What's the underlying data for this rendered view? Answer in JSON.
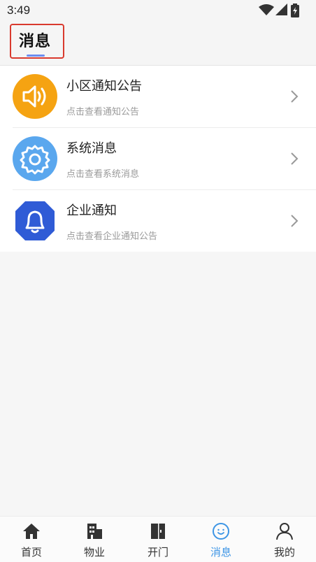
{
  "status_bar": {
    "time": "3:49",
    "icons": [
      "wifi-icon",
      "signal-icon",
      "battery-icon"
    ]
  },
  "header": {
    "title": "消息"
  },
  "messages": [
    {
      "title": "小区通知公告",
      "subtitle": "点击查看通知公告",
      "icon": "speaker-icon",
      "icon_color": "#f5a312"
    },
    {
      "title": "系统消息",
      "subtitle": "点击查看系统消息",
      "icon": "gear-icon",
      "icon_color": "#5aa7ee"
    },
    {
      "title": "企业通知",
      "subtitle": "点击查看企业通知公告",
      "icon": "bell-icon",
      "icon_color": "#2f5bd6"
    }
  ],
  "bottom_nav": [
    {
      "label": "首页",
      "icon": "home-icon"
    },
    {
      "label": "物业",
      "icon": "building-icon"
    },
    {
      "label": "开门",
      "icon": "door-icon"
    },
    {
      "label": "消息",
      "icon": "message-icon",
      "active": true
    },
    {
      "label": "我的",
      "icon": "person-icon"
    }
  ],
  "colors": {
    "accent": "#3d95e5",
    "highlight_border": "#d93a2e"
  }
}
